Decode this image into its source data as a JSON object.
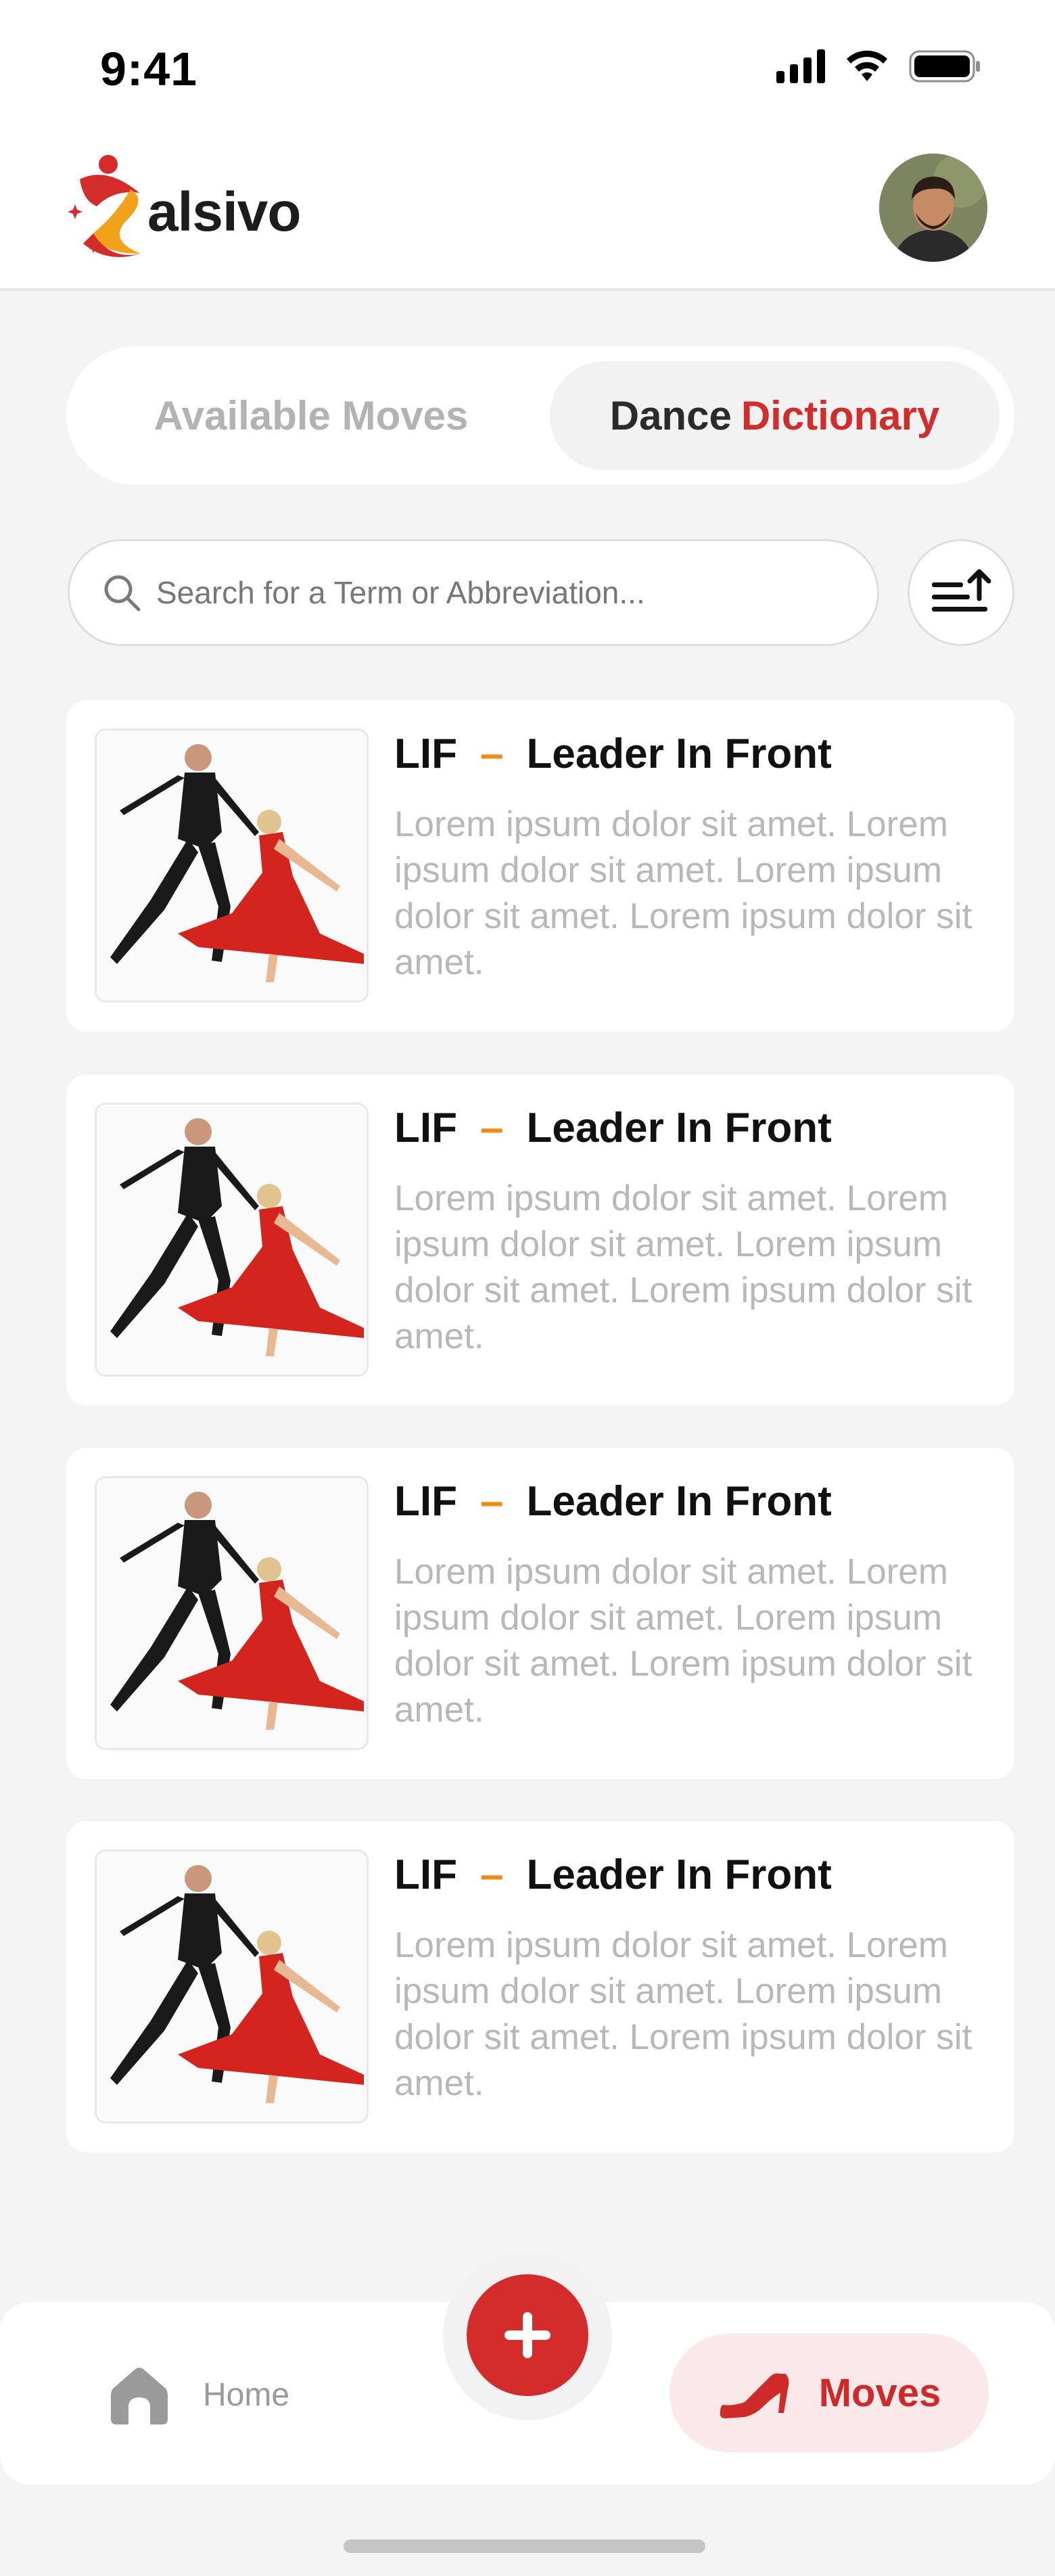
{
  "status_bar": {
    "time": "9:41"
  },
  "header": {
    "logo_text": "alsivo",
    "logo_letter": "S"
  },
  "tabs": {
    "available_moves": "Available Moves",
    "dance_word": "Dance",
    "dictionary_word": "Dictionary"
  },
  "search": {
    "placeholder": "Search for a Term or Abbreviation..."
  },
  "cards": [
    {
      "abbr": "LIF",
      "dash": "–",
      "term": "Leader In Front",
      "description": "Lorem ipsum dolor sit amet. Lorem ipsum dolor sit amet. Lorem ipsum dolor sit amet. Lorem ipsum dolor sit amet."
    },
    {
      "abbr": "LIF",
      "dash": "–",
      "term": "Leader In Front",
      "description": "Lorem ipsum dolor sit amet. Lorem ipsum dolor sit amet. Lorem ipsum dolor sit amet. Lorem ipsum dolor sit amet."
    },
    {
      "abbr": "LIF",
      "dash": "–",
      "term": "Leader In Front",
      "description": "Lorem ipsum dolor sit amet. Lorem ipsum dolor sit amet. Lorem ipsum dolor sit amet. Lorem ipsum dolor sit amet."
    },
    {
      "abbr": "LIF",
      "dash": "–",
      "term": "Leader In Front",
      "description": "Lorem ipsum dolor sit amet. Lorem ipsum dolor sit amet. Lorem ipsum dolor sit amet. Lorem ipsum dolor sit amet."
    }
  ],
  "bottom_nav": {
    "home": "Home",
    "moves": "Moves"
  },
  "colors": {
    "accent": "#d12d2d",
    "dash": "#f08a13",
    "active_tab_bg": "#fbe9e9"
  }
}
